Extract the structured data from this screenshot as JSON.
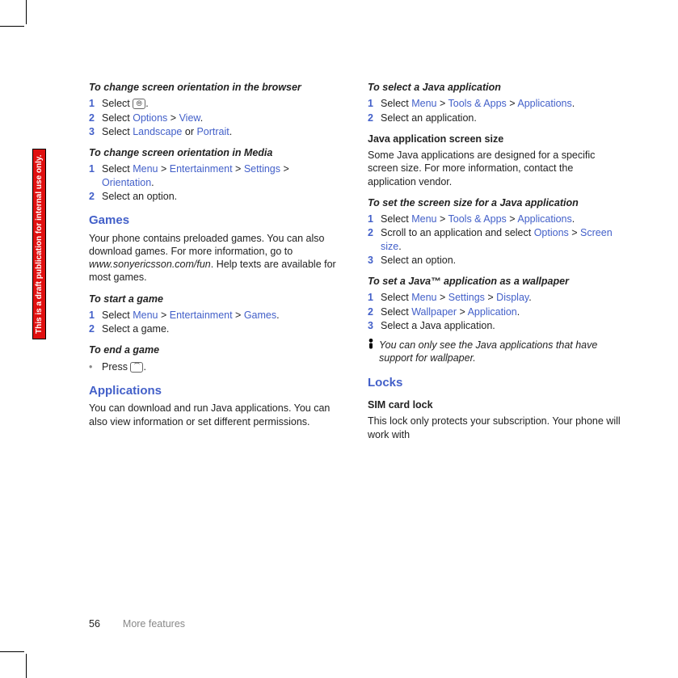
{
  "watermark": "This is a draft publication for internal use only.",
  "footer": {
    "page": "56",
    "section": "More features"
  },
  "icons": {
    "browser": "⦾",
    "end_key": "⏠"
  },
  "col1": {
    "t1": "To change screen orientation in the browser",
    "s1a_pre": "Select ",
    "s1b": {
      "pre": "Select ",
      "a": "Options",
      "mid": " > ",
      "b": "View",
      "post": "."
    },
    "s1c": {
      "pre": "Select ",
      "a": "Landscape",
      "mid": " or ",
      "b": "Portrait",
      "post": "."
    },
    "t2": "To change screen orientation in Media",
    "s2a": {
      "pre": "Select ",
      "a": "Menu",
      "m1": " > ",
      "b": "Entertainment",
      "m2": " > ",
      "c": "Settings",
      "m3": " > ",
      "d": "Orientation",
      "post": "."
    },
    "s2b": "Select an option.",
    "sec_games": "Games",
    "games_body_pre": "Your phone contains preloaded games. You can also download games. For more information, go to ",
    "games_body_link": "www.sonyericsson.com/fun",
    "games_body_post": ". Help texts are available for most games.",
    "t3": "To start a game",
    "s3a": {
      "pre": "Select ",
      "a": "Menu",
      "m1": " > ",
      "b": "Entertainment",
      "m2": " > ",
      "c": "Games",
      "post": "."
    },
    "s3b": "Select a game.",
    "t4": "To end a game",
    "s4a_pre": "Press ",
    "sec_apps": "Applications",
    "apps_body": "You can download and run Java applications. You can also view information or set different permissions."
  },
  "col2": {
    "t1": "To select a Java application",
    "s1a": {
      "pre": "Select ",
      "a": "Menu",
      "m1": " > ",
      "b": "Tools & Apps",
      "m2": " > ",
      "c": "Applications",
      "post": "."
    },
    "s1b": "Select an application.",
    "sub1": "Java application screen size",
    "sub1_body": "Some Java applications are designed for a specific screen size. For more information, contact the application vendor.",
    "t2": "To set the screen size for a Java application",
    "s2a": {
      "pre": "Select ",
      "a": "Menu",
      "m1": " > ",
      "b": "Tools & Apps",
      "m2": " > ",
      "c": "Applications",
      "post": "."
    },
    "s2b": {
      "pre": "Scroll to an application and select ",
      "a": "Options",
      "m1": " > ",
      "b": "Screen size",
      "post": "."
    },
    "s2c": "Select an option.",
    "t3": "To set a Java™ application as a wallpaper",
    "s3a": {
      "pre": "Select ",
      "a": "Menu",
      "m1": " > ",
      "b": "Settings",
      "m2": " > ",
      "c": "Display",
      "post": "."
    },
    "s3b": {
      "pre": "Select ",
      "a": "Wallpaper",
      "m1": " > ",
      "b": "Application",
      "post": "."
    },
    "s3c": "Select a Java application.",
    "tip": "You can only see the Java applications that have support for wallpaper.",
    "sec_locks": "Locks",
    "sub_locks": "SIM card lock",
    "locks_body": "This lock only protects your subscription. Your phone will work with"
  },
  "nums": {
    "n1": "1",
    "n2": "2",
    "n3": "3"
  },
  "bullet": "•"
}
